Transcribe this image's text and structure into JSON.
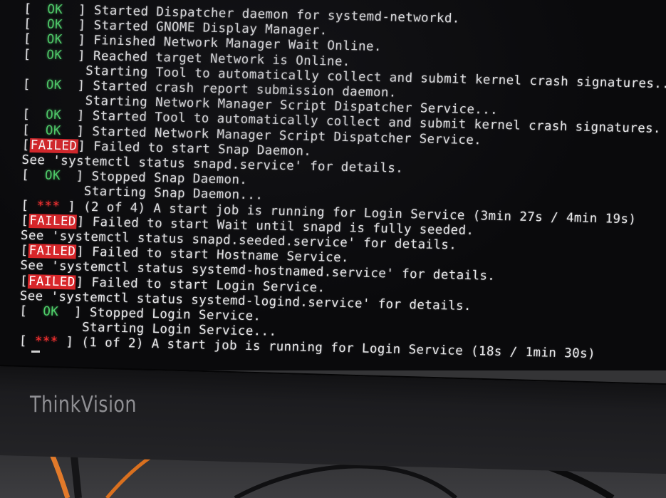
{
  "boot_log": [
    {
      "status": "OK",
      "text": "Started Dispatcher daemon for systemd-networkd."
    },
    {
      "status": "OK",
      "text": "Started GNOME Display Manager."
    },
    {
      "status": "OK",
      "text": "Finished Network Manager Wait Online."
    },
    {
      "status": "OK",
      "text": "Reached target Network is Online."
    },
    {
      "status": "",
      "text": "Starting Tool to automatically collect and submit kernel crash signatures..."
    },
    {
      "status": "OK",
      "text": "Started crash report submission daemon."
    },
    {
      "status": "",
      "text": "Starting Network Manager Script Dispatcher Service..."
    },
    {
      "status": "OK",
      "text": "Started Tool to automatically collect and submit kernel crash signatures."
    },
    {
      "status": "OK",
      "text": "Started Network Manager Script Dispatcher Service."
    },
    {
      "status": "FAILED",
      "text": "Failed to start Snap Daemon."
    },
    {
      "status": "note",
      "text": "See 'systemctl status snapd.service' for details."
    },
    {
      "status": "OK",
      "text": "Stopped Snap Daemon."
    },
    {
      "status": "",
      "text": "Starting Snap Daemon..."
    },
    {
      "status": "***",
      "text": "(2 of 4) A start job is running for Login Service (3min 27s / 4min 19s)"
    },
    {
      "status": "FAILED",
      "text": "Failed to start Wait until snapd is fully seeded."
    },
    {
      "status": "note",
      "text": "See 'systemctl status snapd.seeded.service' for details."
    },
    {
      "status": "FAILED",
      "text": "Failed to start Hostname Service."
    },
    {
      "status": "note",
      "text": "See 'systemctl status systemd-hostnamed.service' for details."
    },
    {
      "status": "FAILED",
      "text": "Failed to start Login Service."
    },
    {
      "status": "note",
      "text": "See 'systemctl status systemd-logind.service' for details."
    },
    {
      "status": "OK",
      "text": "Stopped Login Service."
    },
    {
      "status": "",
      "text": "Starting Login Service..."
    },
    {
      "status": "***",
      "text": "(1 of 2) A start job is running for Login Service (18s / 1min 30s)"
    }
  ],
  "labels": {
    "ok": "OK",
    "failed": "FAILED",
    "stars": "***"
  },
  "monitor": {
    "brand": "ThinkVision"
  },
  "colors": {
    "ok": "#4fcf6a",
    "failed_bg": "#d8262a",
    "stars": "#ff3030",
    "text": "#e8e8ea"
  }
}
